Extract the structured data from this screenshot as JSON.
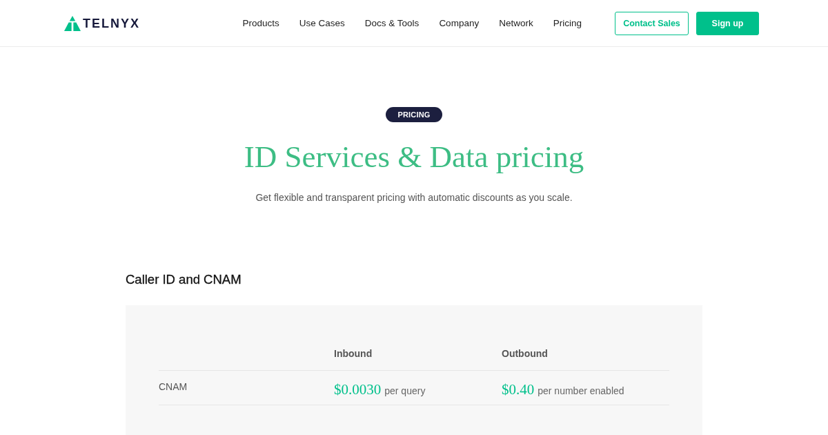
{
  "header": {
    "logo": {
      "text": "TELNYX"
    },
    "nav": [
      {
        "label": "Products"
      },
      {
        "label": "Use Cases"
      },
      {
        "label": "Docs & Tools"
      },
      {
        "label": "Company"
      },
      {
        "label": "Network"
      },
      {
        "label": "Pricing"
      }
    ],
    "buttons": [
      {
        "label": "Contact Sales",
        "kind": "outline"
      },
      {
        "label": "Sign up",
        "kind": "filled"
      }
    ]
  },
  "hero": {
    "badge": "PRICING",
    "title": "ID Services & Data pricing",
    "subtitle": "Get flexible and transparent pricing with automatic discounts as you scale."
  },
  "section": {
    "title": "Caller ID and CNAM",
    "table": {
      "columns": [
        "Inbound",
        "Outbound"
      ],
      "rows": [
        {
          "label": "CNAM",
          "cells": [
            {
              "price": "$0.0030",
              "unit": "per query"
            },
            {
              "price": "$0.40",
              "unit": "per number enabled"
            }
          ]
        }
      ]
    }
  }
}
